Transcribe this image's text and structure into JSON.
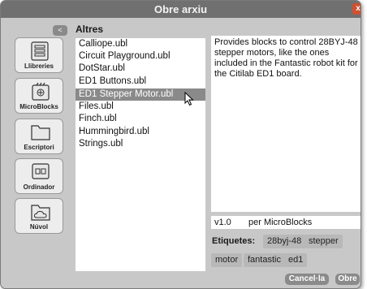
{
  "dialog": {
    "title": "Obre arxiu",
    "close_label": "x"
  },
  "navigation": {
    "back_label": "<",
    "folder_title": "Altres"
  },
  "sidebar": {
    "items": [
      {
        "label": "Llibreries",
        "icon": "library-icon"
      },
      {
        "label": "MicroBlocks",
        "icon": "microblocks-icon"
      },
      {
        "label": "Escriptori",
        "icon": "folder-icon"
      },
      {
        "label": "Ordinador",
        "icon": "computer-icon"
      },
      {
        "label": "Núvol",
        "icon": "cloud-icon"
      }
    ]
  },
  "files": {
    "items": [
      "Calliope.ubl",
      "Circuit Playground.ubl",
      "DotStar.ubl",
      "ED1 Buttons.ubl",
      "ED1 Stepper Motor.ubl",
      "Files.ubl",
      "Finch.ubl",
      "Hummingbird.ubl",
      "Strings.ubl"
    ],
    "selected": "ED1 Stepper Motor.ubl"
  },
  "details": {
    "description": "Provides blocks to control 28BYJ-48 stepper motors, like the ones included in the Fantastic robot kit for the Citilab ED1 board.",
    "version": "v1.0",
    "author": "per MicroBlocks",
    "tags_label": "Etiquetes:",
    "tags": [
      "28byj-48",
      "stepper",
      "motor",
      "fantastic",
      "ed1"
    ]
  },
  "buttons": {
    "cancel_label": "Cancel·la",
    "open_label": "Obre"
  },
  "colors": {
    "titlebar": "#707070",
    "dialog": "#c8c8c8",
    "selection": "#8a8a8a",
    "close": "#d05030"
  }
}
